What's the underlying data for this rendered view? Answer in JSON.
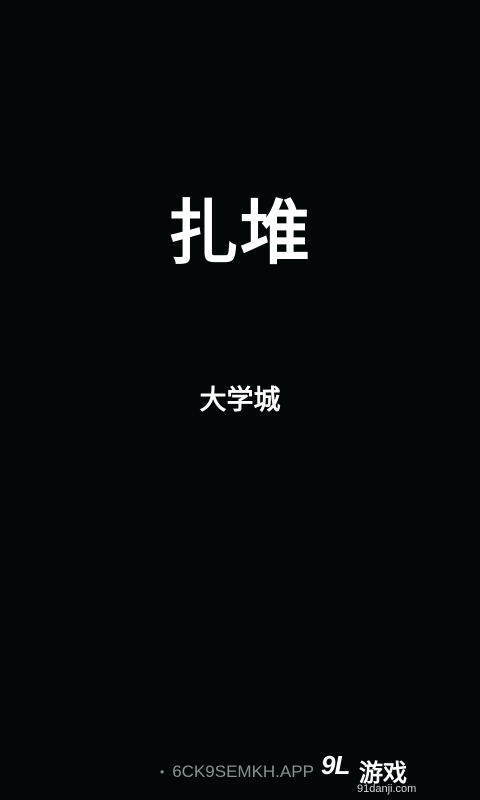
{
  "app": {
    "title": "扎堆",
    "subtitle": "大学城"
  },
  "footer": {
    "app_id": "6CK9SEMKH.APP",
    "bullet": "•"
  },
  "watermark": {
    "logo": "9L",
    "name": "游戏",
    "url": "91danji.com"
  },
  "colors": {
    "background": "#030707",
    "text": "#ffffff",
    "muted": "#8a8f92"
  }
}
